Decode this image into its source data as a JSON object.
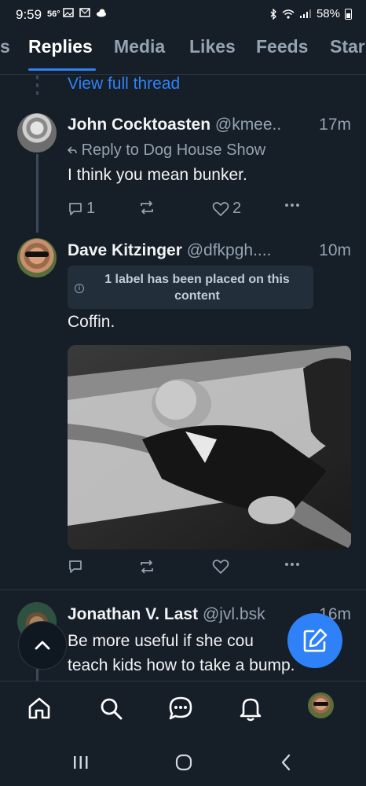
{
  "status_bar": {
    "time": "9:59",
    "temp": "56°",
    "battery": "58%"
  },
  "tabs": [
    {
      "label": "s"
    },
    {
      "label": "Replies"
    },
    {
      "label": "Media"
    },
    {
      "label": "Likes"
    },
    {
      "label": "Feeds"
    },
    {
      "label": "Star"
    }
  ],
  "thread": {
    "view_full_thread": "View full thread"
  },
  "posts": [
    {
      "name": "John Cocktoasten",
      "handle": "@kmee..",
      "time": "17m",
      "reply_to": "Reply to Dog House Show",
      "text": "I think you mean bunker.",
      "reply_count": "1",
      "like_count": "2"
    },
    {
      "name": "Dave Kitzinger",
      "handle": "@dfkpgh....",
      "time": "10m",
      "label_notice": "1 label has been placed on this content",
      "text": "Coffin."
    },
    {
      "name": "Jonathan V. Last",
      "handle": "@jvl.bsk",
      "time": "16m",
      "text_line1": "Be more useful if she cou",
      "text_line2": "teach kids how to take a bump."
    }
  ],
  "icons": {
    "reply": "reply-icon",
    "repost": "repost-icon",
    "like": "heart-icon",
    "more": "more-icon",
    "scroll_top": "chevron-up-icon",
    "compose": "compose-icon",
    "home": "home-icon",
    "search": "search-icon",
    "chat": "chat-icon",
    "notifications": "bell-icon"
  },
  "colors": {
    "background": "#161e27",
    "accent": "#2f81f7",
    "muted": "#94a3b2"
  }
}
